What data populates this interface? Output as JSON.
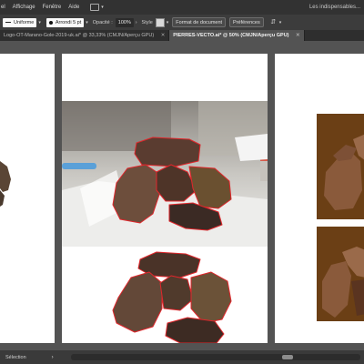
{
  "menu": {
    "items": [
      "el",
      "Affichage",
      "Fenêtre",
      "Aide"
    ],
    "workspace": "Les indispensables..."
  },
  "controls": {
    "stroke_label": "Uniforme",
    "brush_label": "Arrondi 5 pt",
    "opacity_label": "Opacité :",
    "opacity_value": "100%",
    "style_label": "Style",
    "doc_format_button": "Format de document",
    "prefs_button": "Préférences"
  },
  "tabs": [
    {
      "label": "Logo-OT-Marano-Gole-2019-uk.ai* @ 33,33% (CMJN/Aperçu GPU)",
      "active": false
    },
    {
      "label": "PIERRES-VECTO.ai* @ 50% (CMJN/Aperçu GPU)",
      "active": true
    }
  ],
  "status": {
    "selection_label": "Sélection"
  },
  "colors": {
    "ui_dark": "#323232",
    "canvas_bg": "#535353",
    "path_red": "#e0262b",
    "vector_brown_bg": "#6b3f15",
    "vector_stone": "#8a5a3b"
  }
}
